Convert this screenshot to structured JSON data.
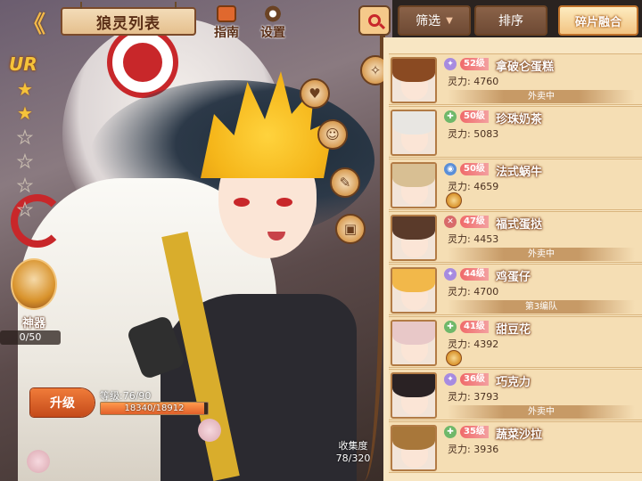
{
  "header": {
    "title": "狼灵列表",
    "back_glyph": "《",
    "guide_label": "指南",
    "settings_label": "设置"
  },
  "hero": {
    "rarity": "UR",
    "stars_total": 6,
    "stars_filled": 2,
    "artifact_label": "神器",
    "artifact_count": "0/50",
    "upgrade_label": "升级",
    "level_text": "等级:76/90",
    "exp_text": "18340/18912",
    "exp_fraction": 0.97,
    "collection_label": "收集度",
    "collection_value": "78/320"
  },
  "toolbar": {
    "filter_label": "筛选",
    "filter_arrow": "▼",
    "sort_label": "排序",
    "fuse_label": "碎片融合"
  },
  "colors": {
    "panel": "#f8e6c3",
    "accent": "#c8272a",
    "level_pill": "#f06a6a",
    "upgrade": "#e2602a"
  },
  "list": [
    {
      "level": "52级",
      "name": "拿破仑蛋糕",
      "power": "灵力: 4760",
      "status": "外卖中",
      "class_color": "#a78be0",
      "class_glyph": "✦",
      "hair": "#8a4a22"
    },
    {
      "level": "50级",
      "name": "珍珠奶茶",
      "power": "灵力: 5083",
      "status": "",
      "class_color": "#6fb86a",
      "class_glyph": "✚",
      "hair": "#e8e6e2"
    },
    {
      "level": "50级",
      "name": "法式蜗牛",
      "power": "灵力: 4659",
      "status": "",
      "class_color": "#5b8fd8",
      "class_glyph": "◉",
      "hair": "#d8bf93",
      "badge": true
    },
    {
      "level": "47级",
      "name": "福式蛋挞",
      "power": "灵力: 4453",
      "status": "外卖中",
      "class_color": "#d86a6a",
      "class_glyph": "✕",
      "hair": "#5a3a2a"
    },
    {
      "level": "44级",
      "name": "鸡蛋仔",
      "power": "灵力: 4700",
      "status": "第3编队",
      "class_color": "#a78be0",
      "class_glyph": "✦",
      "hair": "#f2b84a"
    },
    {
      "level": "41级",
      "name": "甜豆花",
      "power": "灵力: 4392",
      "status": "",
      "class_color": "#6fb86a",
      "class_glyph": "✚",
      "hair": "#e8c8c8",
      "badge": true
    },
    {
      "level": "36级",
      "name": "巧克力",
      "power": "灵力: 3793",
      "status": "外卖中",
      "class_color": "#a78be0",
      "class_glyph": "✦",
      "hair": "#2a2224"
    },
    {
      "level": "35级",
      "name": "蔬菜沙拉",
      "power": "灵力: 3936",
      "status": "",
      "class_color": "#6fb86a",
      "class_glyph": "✚",
      "hair": "#a8773a"
    }
  ],
  "icons": [
    "back-arrow-icon",
    "guide-book-icon",
    "settings-gear-icon",
    "search-icon",
    "dropdown-arrow-icon",
    "heart-icon",
    "card-icon",
    "scroll-icon",
    "chest-icon",
    "star-icon",
    "artifact-icon"
  ]
}
